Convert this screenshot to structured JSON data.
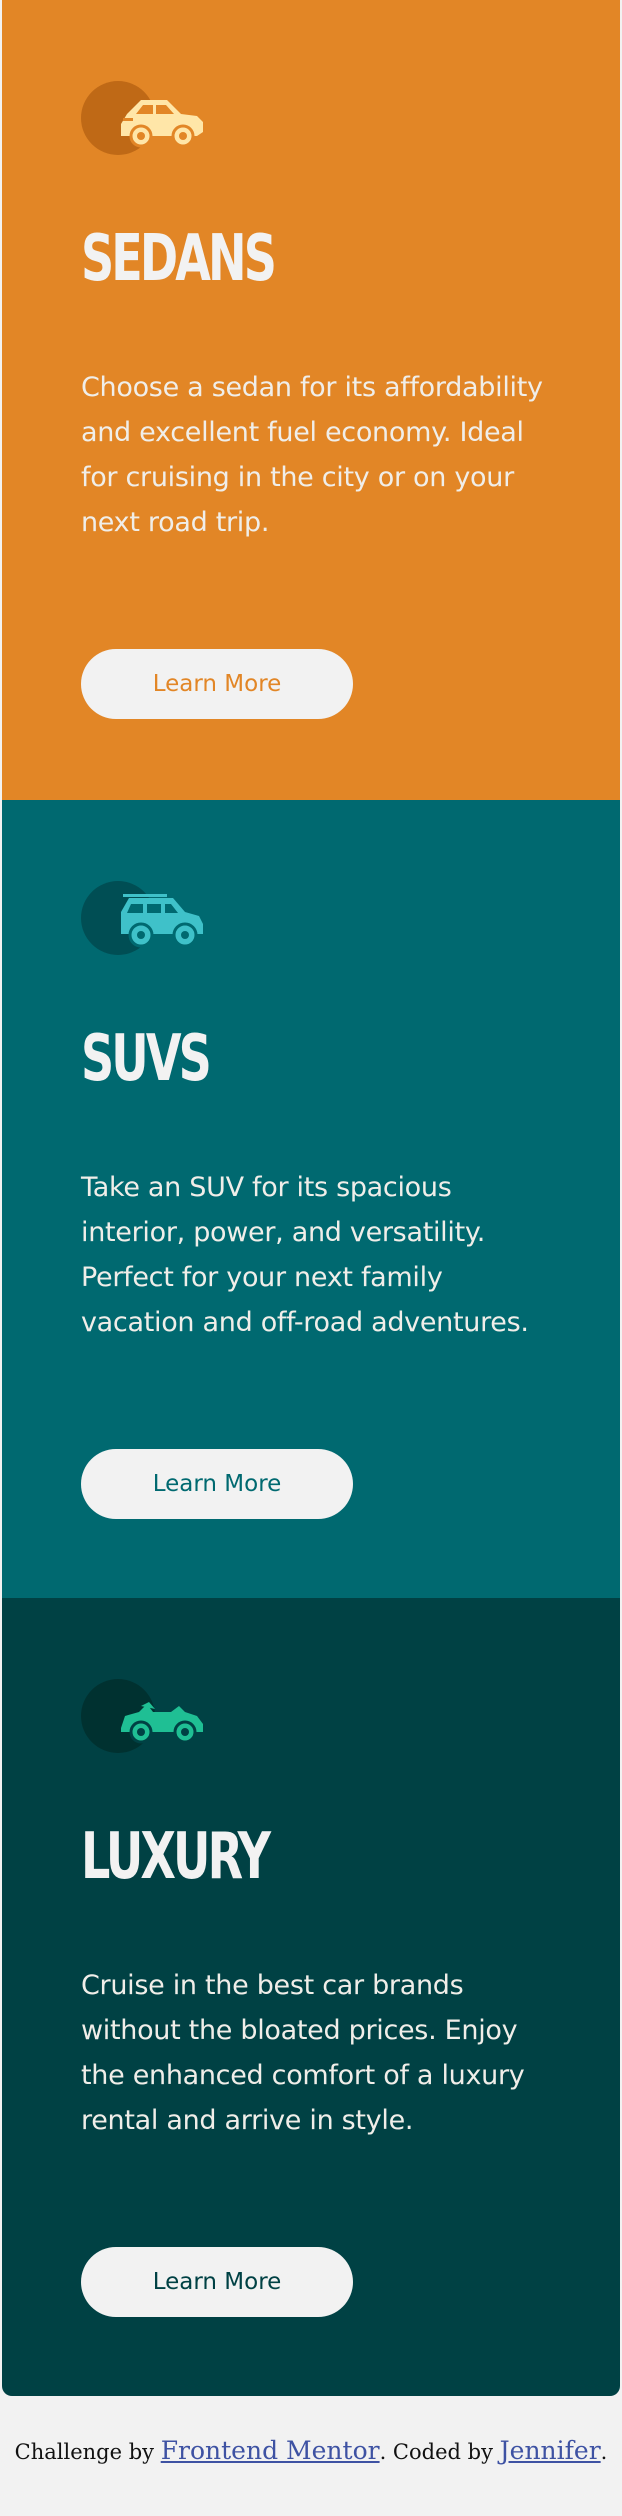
{
  "cards": [
    {
      "id": "sedans",
      "title": "Sedans",
      "description": "Choose a sedan for its affordability and excellent fuel economy. Ideal for cruising in the city or on your next road trip.",
      "button_label": "Learn More",
      "icon": "sedan-car-icon",
      "background_color": "#e28626",
      "icon_color": "#ffe6a8"
    },
    {
      "id": "suvs",
      "title": "SUVs",
      "description": "Take an SUV for its spacious interior, power, and versatility. Perfect for your next family vacation and off-road adventures.",
      "button_label": "Learn More",
      "icon": "suv-car-icon",
      "background_color": "#006970",
      "icon_color": "#3fc1c9"
    },
    {
      "id": "luxury",
      "title": "Luxury",
      "description": "Cruise in the best car brands without the bloated prices. Enjoy the enhanced comfort of a luxury rental and arrive in style.",
      "button_label": "Learn More",
      "icon": "luxury-car-icon",
      "background_color": "#004144",
      "icon_color": "#1fbf94"
    }
  ],
  "attribution": {
    "prefix": "Challenge by ",
    "challenge_link": "Frontend Mentor",
    "middle": ". Coded by ",
    "author_link": "Jennifer",
    "suffix": "."
  },
  "colors": {
    "page_background": "#f2f2f2",
    "button_background": "#f2f2f2",
    "text_light": "#f2f2f2",
    "link": "#3e52a3"
  }
}
